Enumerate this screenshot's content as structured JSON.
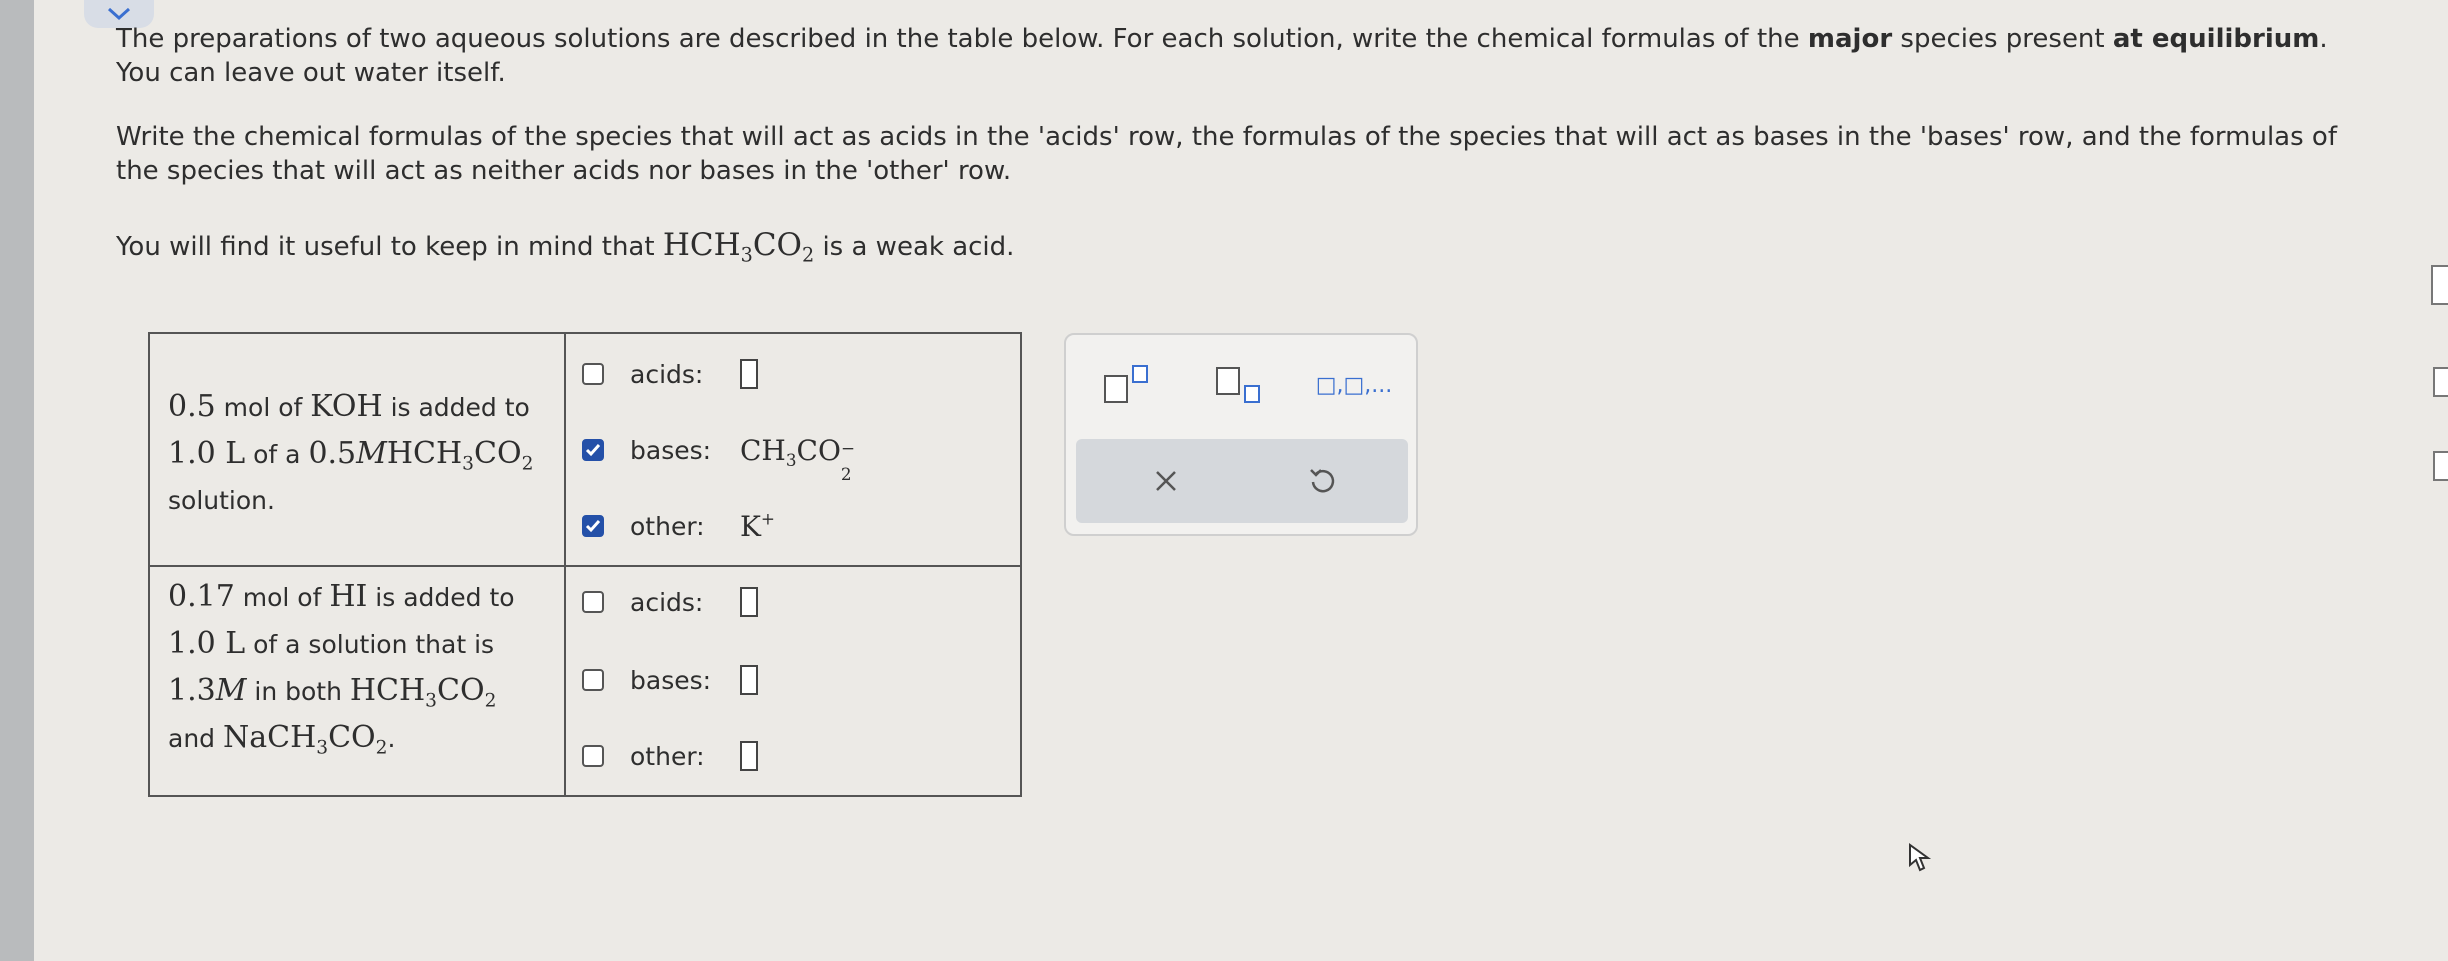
{
  "prompt": {
    "p1_part1": "The preparations of two aqueous solutions are described in the table below. For each solution, write the chemical formulas of the ",
    "p1_bold1": "major",
    "p1_part2": " species present ",
    "p1_bold2": "at equilibrium",
    "p1_part3": ". You can leave out water itself.",
    "p2": "Write the chemical formulas of the species that will act as acids in the 'acids' row, the formulas of the species that will act as bases in the 'bases' row, and the formulas of the species that will act as neither acids nor bases in the 'other' row.",
    "p3_prefix": "You will find it useful to keep in mind that ",
    "p3_formula_a": "HCH",
    "p3_formula_sub1": "3",
    "p3_formula_b": "CO",
    "p3_formula_sub2": "2",
    "p3_suffix": " is a weak acid."
  },
  "solutions": [
    {
      "desc_l1_num": "0.5",
      "desc_l1_text": " mol of ",
      "desc_l1_chem": "KOH",
      "desc_l1_end": " is added to",
      "desc_l2_num": "1.0 L",
      "desc_l2_text": " of a ",
      "desc_l2_conc": "0.5",
      "desc_l2_M": "M",
      "desc_l2_chem_a": "HCH",
      "desc_l2_sub1": "3",
      "desc_l2_chem_b": "CO",
      "desc_l2_sub2": "2",
      "desc_l3": "solution.",
      "rows": [
        {
          "label": "acids:",
          "checked": false
        },
        {
          "label": "bases:",
          "checked": true,
          "answer_a": "CH",
          "answer_sub1": "3",
          "answer_b": "CO",
          "answer_sub2": "2",
          "answer_sup": "−"
        },
        {
          "label": "other:",
          "checked": true,
          "answer_a": "K",
          "answer_sup": "+"
        }
      ]
    },
    {
      "desc_l1_num": "0.17",
      "desc_l1_text": " mol of ",
      "desc_l1_chem": "HI",
      "desc_l1_end": " is added to",
      "desc_l2": "1.0 L",
      "desc_l2_text": " of a solution that is",
      "desc_l3_conc": "1.3",
      "desc_l3_M": "M",
      "desc_l3_text": " in both ",
      "desc_l3_chem_a": "HCH",
      "desc_l3_sub1": "3",
      "desc_l3_chem_b": "CO",
      "desc_l3_sub2": "2",
      "desc_l4_text": "and ",
      "desc_l4_chem_a": "NaCH",
      "desc_l4_sub1": "3",
      "desc_l4_chem_b": "CO",
      "desc_l4_sub2": "2",
      "desc_l4_end": ".",
      "rows": [
        {
          "label": "acids:",
          "checked": false
        },
        {
          "label": "bases:",
          "checked": false
        },
        {
          "label": "other:",
          "checked": false
        }
      ]
    }
  ],
  "toolbox": {
    "icons": [
      "superscript-template-icon",
      "subscript-template-icon",
      "list-template-icon"
    ],
    "list_label": "□,□,...",
    "clear_icon": "x-icon",
    "undo_icon": "undo-icon"
  },
  "colors": {
    "checkbox_checked": "#2450a8",
    "background": "#eceae6",
    "toolbar_button_bg": "#d5d8dc"
  }
}
